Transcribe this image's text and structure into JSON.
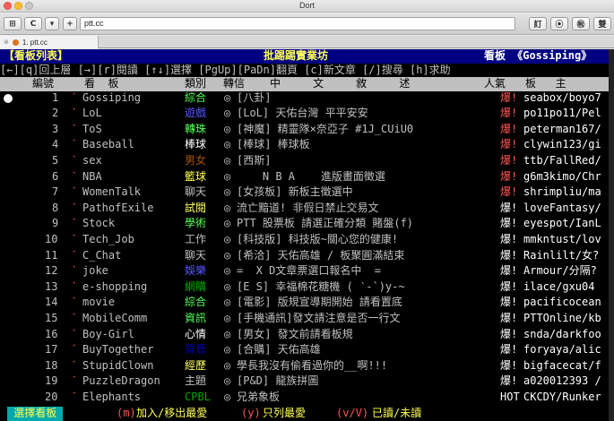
{
  "window": {
    "title": "Dort",
    "url": "ptt.cc",
    "tab_label": "1. ptt.cc",
    "toolbar_right": [
      "訂",
      "⦿",
      "㊗",
      "雙"
    ]
  },
  "header": {
    "left": "【看板列表】",
    "center": "批踢踢實業坊",
    "right": "看板 《Gossiping》"
  },
  "keys_line": "[←][q]回上層 [→][r]閱讀 [↑↓]選擇 [PgUp][PaDn]翻頁 [c]新文章 [/]搜尋 [h]求助",
  "columns": {
    "num": "編號",
    "board": "看  板",
    "cat": "類別",
    "trans": "轉信",
    "desc": "中     文     敘     述",
    "pop": "人氣",
    "mod": "板   主"
  },
  "boards": [
    {
      "num": "1",
      "name": "Gossiping",
      "cat": "綜合",
      "cat_color": "#55ff55",
      "desc": "[八卦]",
      "pop": "爆!",
      "pop_color": "#ff5555",
      "mod": "seabox/boyo7"
    },
    {
      "num": "2",
      "name": "LoL",
      "cat": "遊戲",
      "cat_color": "#5555ff",
      "desc": "[LoL] 天佑台灣 平平安安",
      "pop": "爆!",
      "pop_color": "#ff5555",
      "mod": "po11po11/Pel"
    },
    {
      "num": "3",
      "name": "ToS",
      "cat": "轉珠",
      "cat_color": "#55ff55",
      "desc": "[神魔] 精靈隊×奈亞子 #1J_CUiU0",
      "pop": "爆!",
      "pop_color": "#ff5555",
      "mod": "peterman167/"
    },
    {
      "num": "4",
      "name": "Baseball",
      "cat": "棒球",
      "cat_color": "#ffffff",
      "desc": "[棒球] 棒球板",
      "pop": "爆!",
      "pop_color": "#ff5555",
      "mod": "clywin123/gi"
    },
    {
      "num": "5",
      "name": "sex",
      "cat": "男女",
      "cat_color": "#aa5500",
      "desc": "[西斯]",
      "pop": "爆!",
      "pop_color": "#ff5555",
      "mod": "ttb/FallRed/"
    },
    {
      "num": "6",
      "name": "NBA",
      "cat": "籃球",
      "cat_color": "#ffff55",
      "desc": "    N B A    進版畫面徵選",
      "pop": "爆!",
      "pop_color": "#ff5555",
      "mod": "g6m3kimo/Chr"
    },
    {
      "num": "7",
      "name": "WomenTalk",
      "cat": "聊天",
      "cat_color": "#c0c0c0",
      "desc": "[女孩板] 新板主徵選中",
      "pop": "爆!",
      "pop_color": "#ff5555",
      "mod": "shrimpliu/ma"
    },
    {
      "num": "8",
      "name": "PathofExile",
      "cat": "試閱",
      "cat_color": "#ffff55",
      "desc": "流亡黯道! 非假日禁止交易文",
      "pop": "爆!",
      "pop_color": "#ffffff",
      "mod": "loveFantasy/"
    },
    {
      "num": "9",
      "name": "Stock",
      "cat": "學術",
      "cat_color": "#55ff55",
      "desc": "PTT 股票板 請選正確分類 賭盤(f)",
      "pop": "爆!",
      "pop_color": "#ffffff",
      "mod": "eyespot/IanL"
    },
    {
      "num": "10",
      "name": "Tech_Job",
      "cat": "工作",
      "cat_color": "#c0c0c0",
      "desc": "[科技版] 科技版~關心您的健康!",
      "pop": "爆!",
      "pop_color": "#ffffff",
      "mod": "mmkntust/lov"
    },
    {
      "num": "11",
      "name": "C_Chat",
      "cat": "聊天",
      "cat_color": "#c0c0c0",
      "desc": "[希洽] 天佑高雄 / 板聚圓滿結束",
      "pop": "爆!",
      "pop_color": "#ffffff",
      "mod": "Rainlilt/女?"
    },
    {
      "num": "12",
      "name": "joke",
      "cat": "娛樂",
      "cat_color": "#5555ff",
      "desc": "=  X D文章票選口報名中  =",
      "pop": "爆!",
      "pop_color": "#ffffff",
      "mod": "Armour/分隔?"
    },
    {
      "num": "13",
      "name": "e-shopping",
      "cat": "網購",
      "cat_color": "#00aa00",
      "desc": "[E S] 幸福棉花糖機 ( ‵-`)y-~",
      "pop": "爆!",
      "pop_color": "#ffffff",
      "mod": "ilace/gxu04"
    },
    {
      "num": "14",
      "name": "movie",
      "cat": "綜合",
      "cat_color": "#55ff55",
      "desc": "[電影] 版規宣導期開始 請看置底",
      "pop": "爆!",
      "pop_color": "#ffffff",
      "mod": "pacificocean"
    },
    {
      "num": "15",
      "name": "MobileComm",
      "cat": "資訊",
      "cat_color": "#55ff55",
      "desc": "[手機通訊]發文請注意是否一行文",
      "pop": "爆!",
      "pop_color": "#ffffff",
      "mod": "PTTOnline/kb"
    },
    {
      "num": "16",
      "name": "Boy-Girl",
      "cat": "心情",
      "cat_color": "#ffffff",
      "desc": "[男女] 發文前請看板規",
      "pop": "爆!",
      "pop_color": "#ffffff",
      "mod": "snda/darkfoo"
    },
    {
      "num": "17",
      "name": "BuyTogether",
      "cat": "買賣",
      "cat_color": "#0000aa",
      "desc": "[合購] 天佑高雄",
      "pop": "爆!",
      "pop_color": "#ffffff",
      "mod": "foryaya/alic"
    },
    {
      "num": "18",
      "name": "StupidClown",
      "cat": "經歷",
      "cat_color": "#ffff55",
      "desc": "學長我沒有偷看過你的__啊!!!",
      "pop": "爆!",
      "pop_color": "#ffffff",
      "mod": "bigfacecat/f"
    },
    {
      "num": "19",
      "name": "PuzzleDragon",
      "cat": "主題",
      "cat_color": "#c0c0c0",
      "desc": "[P&D] 龍族拼圖",
      "pop": "爆!",
      "pop_color": "#ffffff",
      "mod": "a020012393 /"
    },
    {
      "num": "20",
      "name": "Elephants",
      "cat": "CPBL",
      "cat_color": "#00aa00",
      "desc": "兄弟象板",
      "pop": "HOT",
      "pop_color": "#ffffff",
      "mod": "CKCDY/Runker"
    }
  ],
  "footer": {
    "left": " 選擇看板 ",
    "k1": "(m)",
    "t1": "加入/移出最愛 ",
    "k2": "(y)",
    "t2": "只列最愛 ",
    "k3": "(v/V)",
    "t3": "已讀/未讀"
  }
}
